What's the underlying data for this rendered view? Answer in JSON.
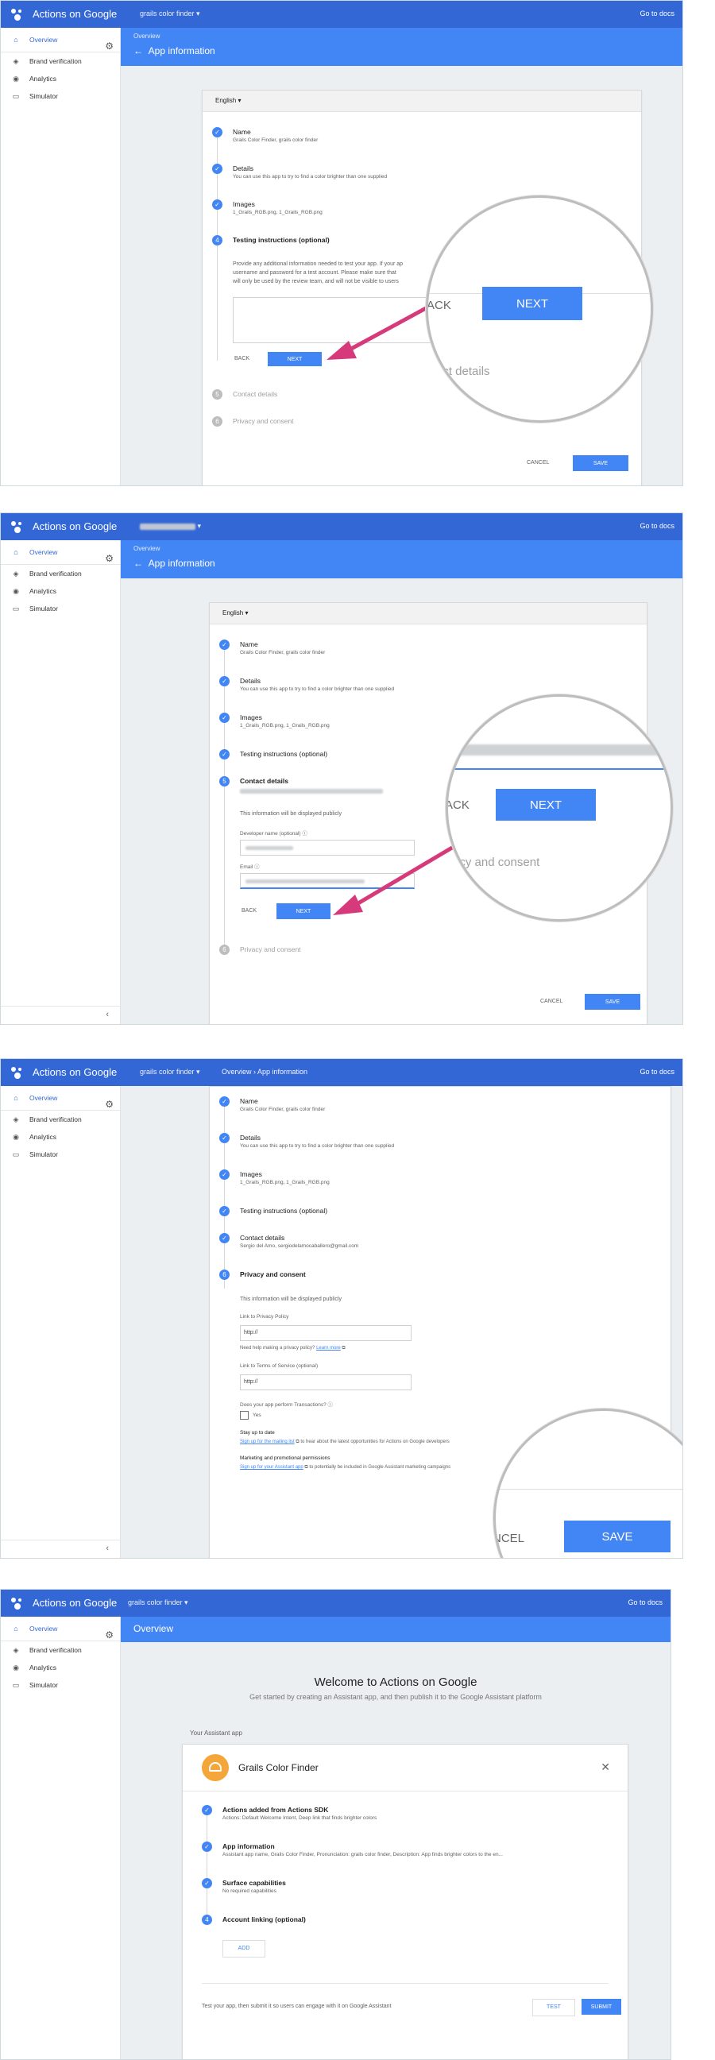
{
  "app": {
    "brand": "Actions on Google",
    "project": "grails color finder",
    "goto": "Go to docs",
    "sidebar": {
      "overview": "Overview",
      "items": [
        "Brand verification",
        "Analytics",
        "Simulator"
      ]
    }
  },
  "header": {
    "crumb": "Overview",
    "title": "App information",
    "overview_title": "Overview"
  },
  "form": {
    "language": "English",
    "steps": {
      "name": {
        "label": "Name",
        "value": "Grails Color Finder, grails color finder"
      },
      "details": {
        "label": "Details",
        "value": "You can use this app to try to find a color brighter than one supplied"
      },
      "images": {
        "label": "Images",
        "value": "1_Grails_RGB.png, 1_Grails_RGB.png"
      },
      "testing": {
        "label": "Testing instructions (optional)"
      },
      "contact": {
        "label": "Contact details",
        "value": "Sergio del Amo, sergiodelamocaballero@gmail.com"
      },
      "privacy": {
        "label": "Privacy and consent"
      }
    },
    "testing_help_1": "Provide any additional information needed to test your app. If your ap",
    "testing_help_2": "username and password for a test account. Please make sure that",
    "testing_help_3": "will only be used by the review team, and will not be visible to users",
    "public_note": "This information will be displayed publicly",
    "developer_name_label": "Developer name (optional)",
    "email_label": "Email",
    "privacy_link_label": "Link to Privacy Policy",
    "privacy_placeholder": "http://",
    "privacy_help": "Need help making a privacy policy?",
    "learn_more": "Learn more",
    "terms_label": "Link to Terms of Service (optional)",
    "terms_placeholder": "http://",
    "transactions_q": "Does your app perform Transactions?",
    "yes": "Yes",
    "stay_label": "Stay up to date",
    "stay_link": "Sign up for the mailing list",
    "stay_rest": "to hear about the latest opportunities for Actions on Google developers",
    "marketing_label": "Marketing and promotional permissions",
    "marketing_link": "Sign up for your Assistant app",
    "marketing_rest": "to potentially be included in Google Assistant marketing campaigns",
    "back": "BACK",
    "next": "NEXT",
    "cancel": "CANCEL",
    "save": "SAVE",
    "zoom_back": "ACK",
    "zoom_contact": "act details",
    "zoom_privacy": "acy and consent",
    "zoom_cancel": "NCEL"
  },
  "overview": {
    "welcome_title": "Welcome to Actions on Google",
    "welcome_sub": "Get started by creating an Assistant app, and then publish it to the Google Assistant platform",
    "your_app": "Your Assistant app",
    "app_name": "Grails Color Finder",
    "items": [
      {
        "title": "Actions added from Actions SDK",
        "sub": "Actions: Default Welcome Intent, Deep link that finds brighter colors"
      },
      {
        "title": "App information",
        "sub": "Assistant app name, Grails Color Finder, Pronunciation: grails color finder, Description: App finds brighter colors to the en..."
      },
      {
        "title": "Surface capabilities",
        "sub": "No required capabilities"
      },
      {
        "title": "Account linking (optional)",
        "sub": ""
      }
    ],
    "add": "ADD",
    "footer_note": "Test your app, then submit it so users can engage with it on Google Assistant",
    "test": "TEST",
    "submit": "SUBMIT",
    "step4": "4"
  },
  "colors": {
    "topbar": "#3367d6",
    "header": "#4285f4",
    "accent": "#4285f4",
    "arrow": "#d63a7a"
  }
}
